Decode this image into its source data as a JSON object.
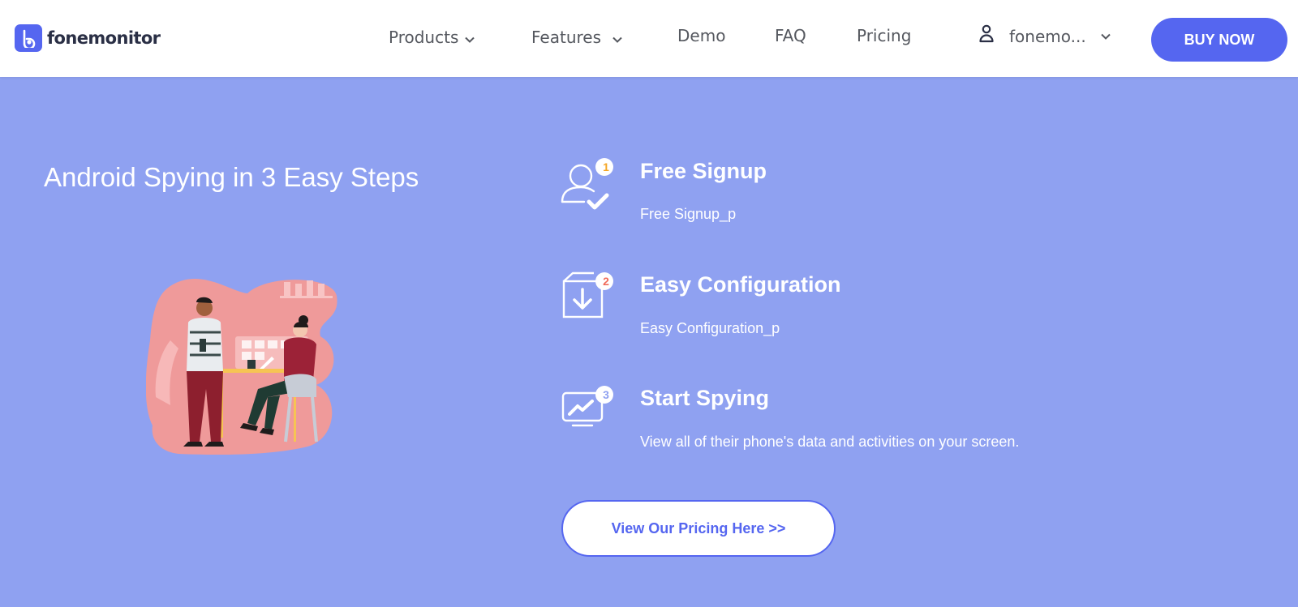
{
  "header": {
    "logo_text": "fonemonitor",
    "nav": {
      "products": "Products",
      "features": "Features",
      "demo": "Demo",
      "faq": "FAQ",
      "pricing": "Pricing"
    },
    "user_name": "fonemo...",
    "buy_label": "BUY NOW"
  },
  "hero": {
    "title": "Android Spying in 3 Easy Steps"
  },
  "steps": [
    {
      "number": "1",
      "title": "Free Signup",
      "desc": "Free Signup_p",
      "icon": "user-check-icon"
    },
    {
      "number": "2",
      "title": "Easy Configuration",
      "desc": "Easy Configuration_p",
      "icon": "download-box-icon"
    },
    {
      "number": "3",
      "title": "Start Spying",
      "desc": "View all of their phone's data and activities on your screen.",
      "icon": "monitor-chart-icon"
    }
  ],
  "cta_label": "View Our Pricing Here >>",
  "colors": {
    "accent": "#5566f0",
    "hero_background": "#8fa1f1",
    "badge_1": "#f5a623",
    "badge_2": "#f06b5a",
    "badge_3": "#8fa1f1"
  }
}
